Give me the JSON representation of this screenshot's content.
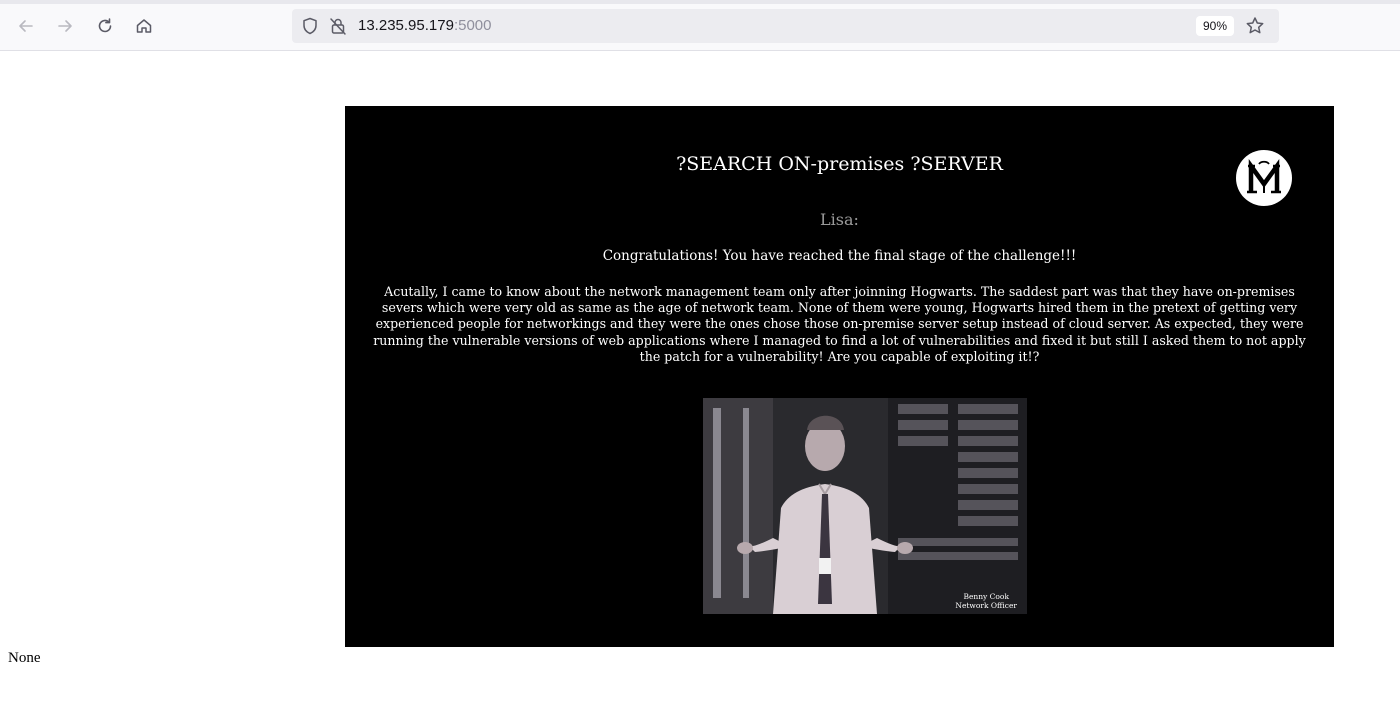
{
  "browser": {
    "url_host": "13.235.95.179",
    "url_port": ":5000",
    "zoom": "90%",
    "icons": [
      "back-icon",
      "forward-icon",
      "reload-icon",
      "home-icon",
      "shield-icon",
      "lock-icon",
      "bookmark-star-icon"
    ]
  },
  "page": {
    "heading": "?SEARCH ON-premises ?SERVER",
    "speaker": "Lisa:",
    "congrats": "Congratulations! You have reached the final stage of the challenge!!!",
    "story": "Acutally, I came to know about the network management team only after joinning Hogwarts. The saddest part was that they have on-premises severs which were very old as same as the age of network team. None of them were young, Hogwarts hired them in the pretext of getting very experienced people for networkings and they were the ones chose those on-premise server setup instead of cloud server. As expected, they were running the vulnerable versions of web applications where I managed to find a lot of vulnerabilities and fixed it but still I asked them to not apply the patch for a vulnerability! Are you capable of exploiting it!?",
    "photo_caption_name": "Benny Cook",
    "photo_caption_role": "Network Officer",
    "footer_text": "None"
  },
  "colors": {
    "panel_background": "#000000",
    "page_background": "#ffffff",
    "speaker_color": "#9a9a9a"
  }
}
